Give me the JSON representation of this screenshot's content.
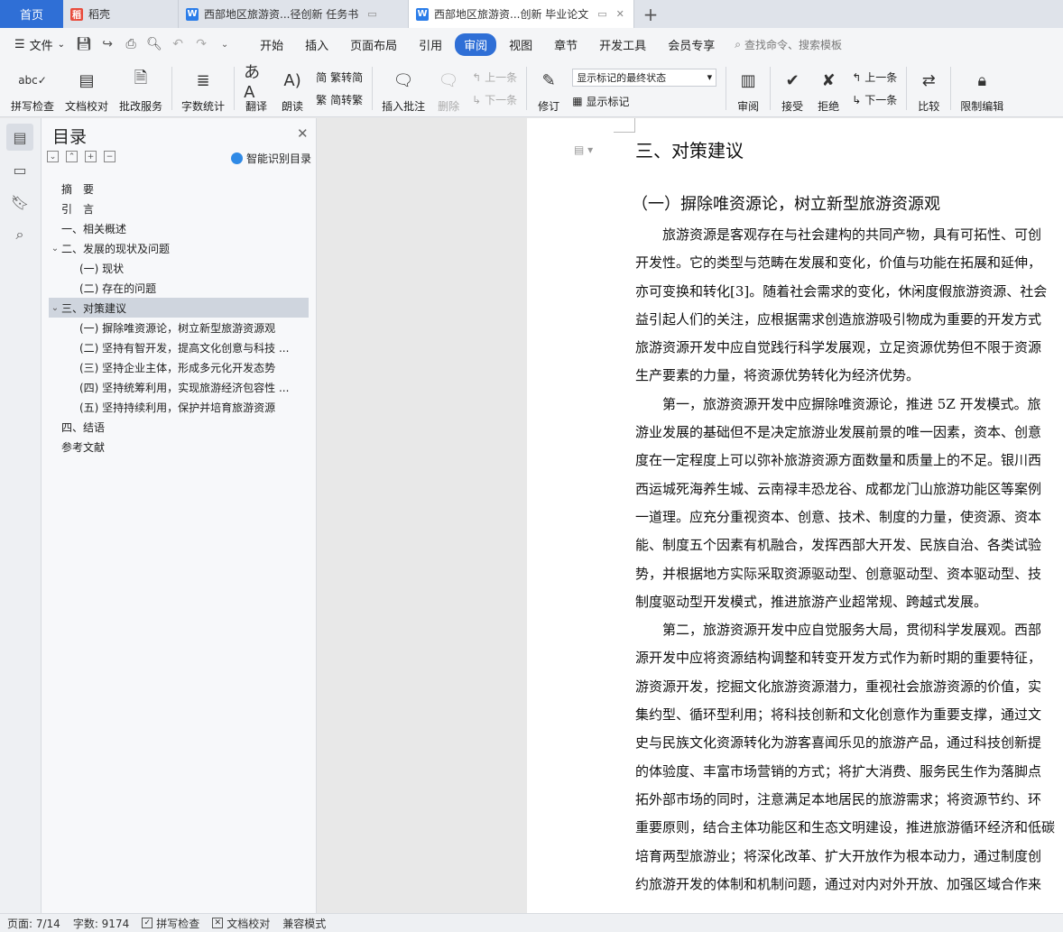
{
  "tabs": {
    "home": "首页",
    "items": [
      {
        "label": "稻壳",
        "icon": "docer-logo-icon"
      },
      {
        "label": "西部地区旅游资...径创新 任务书",
        "icon": "wps-writer-icon"
      },
      {
        "label": "西部地区旅游资...创新 毕业论文",
        "icon": "wps-writer-icon"
      }
    ],
    "add": "+"
  },
  "menu": {
    "file": "文件",
    "items": [
      "开始",
      "插入",
      "页面布局",
      "引用",
      "审阅",
      "视图",
      "章节",
      "开发工具",
      "会员专享"
    ],
    "active": "审阅",
    "search": "查找命令、搜索模板"
  },
  "ribbon": {
    "spell": "拼写检查",
    "proof": "文档校对",
    "review_service": "批改服务",
    "word_count": "字数统计",
    "translate": "翻译",
    "read_aloud": "朗读",
    "to_traditional": "繁转简",
    "to_simplified": "简转繁",
    "insert_comment": "插入批注",
    "delete": "删除",
    "prev_comment": "上一条",
    "next_comment": "下一条",
    "revise": "修订",
    "markup_mode": "显示标记的最终状态",
    "show_markup": "显示标记",
    "review_pane": "审阅",
    "accept": "接受",
    "reject": "拒绝",
    "prev_change": "上一条",
    "next_change": "下一条",
    "compare": "比较",
    "restrict_edit": "限制编辑"
  },
  "toc": {
    "title": "目录",
    "ai_label": "智能识别目录",
    "items": [
      {
        "label": "摘　要",
        "level": 1,
        "expand": ""
      },
      {
        "label": "引　言",
        "level": 1,
        "expand": ""
      },
      {
        "label": "一、相关概述",
        "level": 1,
        "expand": ""
      },
      {
        "label": "二、发展的现状及问题",
        "level": 1,
        "expand": "⌄"
      },
      {
        "label": "(一) 现状",
        "level": 2,
        "expand": ""
      },
      {
        "label": "(二) 存在的问题",
        "level": 2,
        "expand": ""
      },
      {
        "label": "三、对策建议",
        "level": 1,
        "expand": "⌄"
      },
      {
        "label": "(一) 摒除唯资源论，树立新型旅游资源观",
        "level": 2,
        "expand": ""
      },
      {
        "label": "(二) 坚持有智开发，提高文化创意与科技 ...",
        "level": 2,
        "expand": ""
      },
      {
        "label": "(三) 坚持企业主体，形成多元化开发态势",
        "level": 2,
        "expand": ""
      },
      {
        "label": "(四) 坚持统筹利用，实现旅游经济包容性 ...",
        "level": 2,
        "expand": ""
      },
      {
        "label": "(五) 坚持持续利用，保护并培育旅游资源",
        "level": 2,
        "expand": ""
      },
      {
        "label": "四、结语",
        "level": 1,
        "expand": ""
      },
      {
        "label": "参考文献",
        "level": 1,
        "expand": ""
      }
    ],
    "selected_index": 6
  },
  "doc": {
    "heading1": "三、对策建议",
    "heading2": "（一）摒除唯资源论，树立新型旅游资源观",
    "lines": [
      "　　旅游资源是客观存在与社会建构的共同产物，具有可拓性、可创",
      "开发性。它的类型与范畴在发展和变化，价值与功能在拓展和延伸，",
      "亦可变换和转化[3]。随着社会需求的变化，休闲度假旅游资源、社会",
      "益引起人们的关注，应根据需求创造旅游吸引物成为重要的开发方式",
      "旅游资源开发中应自觉践行科学发展观，立足资源优势但不限于资源",
      "生产要素的力量，将资源优势转化为经济优势。",
      "　　第一，旅游资源开发中应摒除唯资源论，推进 5Z 开发模式。旅",
      "游业发展的基础但不是决定旅游业发展前景的唯一因素，资本、创意",
      "度在一定程度上可以弥补旅游资源方面数量和质量上的不足。银川西",
      "西运城死海养生城、云南禄丰恐龙谷、成都龙门山旅游功能区等案例",
      "一道理。应充分重视资本、创意、技术、制度的力量，使资源、资本",
      "能、制度五个因素有机融合，发挥西部大开发、民族自治、各类试验",
      "势，并根据地方实际采取资源驱动型、创意驱动型、资本驱动型、技",
      "制度驱动型开发模式，推进旅游产业超常规、跨越式发展。",
      "　　第二，旅游资源开发中应自觉服务大局，贯彻科学发展观。西部",
      "源开发中应将资源结构调整和转变开发方式作为新时期的重要特征，",
      "游资源开发，挖掘文化旅游资源潜力，重视社会旅游资源的价值，实",
      "集约型、循环型利用；将科技创新和文化创意作为重要支撑，通过文",
      "史与民族文化资源转化为游客喜闻乐见的旅游产品，通过科技创新提",
      "的体验度、丰富市场营销的方式；将扩大消费、服务民生作为落脚点",
      "拓外部市场的同时，注意满足本地居民的旅游需求；将资源节约、环",
      "重要原则，结合主体功能区和生态文明建设，推进旅游循环经济和低碳",
      "培育两型旅游业；将深化改革、扩大开放作为根本动力，通过制度创",
      "约旅游开发的体制和机制问题，通过对内对外开放、加强区域合作来"
    ]
  },
  "status": {
    "page": "页面: 7/14",
    "words": "字数: 9174",
    "spell": "拼写检查",
    "proof": "文档校对",
    "compat": "兼容模式"
  }
}
